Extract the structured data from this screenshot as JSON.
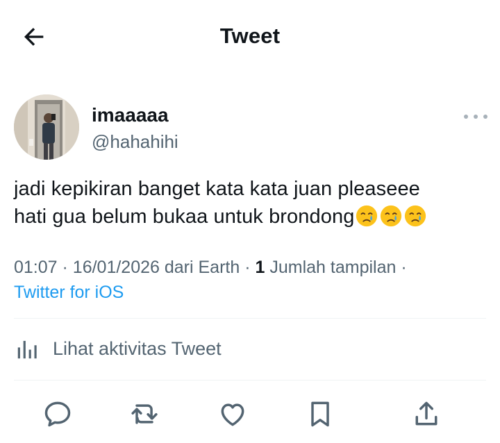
{
  "header": {
    "title": "Tweet",
    "back_icon": "arrow-left-icon"
  },
  "author": {
    "display_name": "imaaaaa",
    "handle": "@hahahihi",
    "avatar": "avatar-photo",
    "more_icon": "more-dots-icon"
  },
  "tweet": {
    "lines": [
      "jadi kepikiran banget kata kata juan pleaseee",
      "hati gua belum bukaa untuk brondong"
    ],
    "emojis": [
      "crying-face",
      "crying-face",
      "crying-face"
    ]
  },
  "meta": {
    "time": "01:07",
    "date": "16/01/2026",
    "location": "dari Earth",
    "views_count": "1",
    "views_label": "Jumlah tampilan",
    "sep": "·",
    "client": "Twitter for iOS"
  },
  "activity": {
    "label": "Lihat aktivitas Tweet",
    "icon": "bar-chart-icon"
  },
  "actions": {
    "reply_icon": "reply-icon",
    "retweet_icon": "retweet-icon",
    "like_icon": "heart-icon",
    "bookmark_icon": "bookmark-icon",
    "share_icon": "share-icon"
  },
  "colors": {
    "text": "#0f1419",
    "secondary": "#536471",
    "link": "#1d9bf0",
    "divider": "#eff3f4",
    "emoji_face": "#fcc21b",
    "emoji_tear": "#4aa3df"
  }
}
